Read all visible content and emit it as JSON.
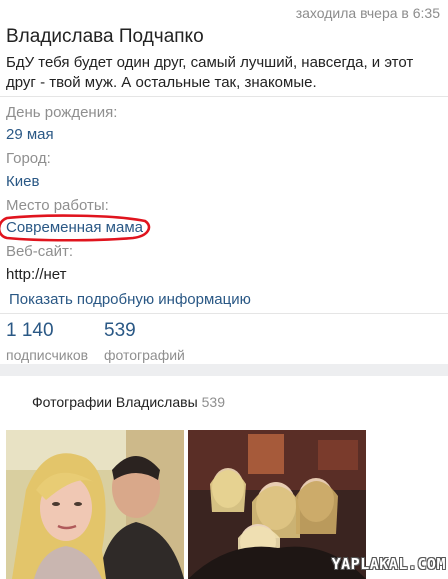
{
  "profile": {
    "last_seen": "заходила вчера в 6:35",
    "name": "Владислава Подчапко",
    "status": "БдУ тебя будет один друг, самый лучший, навсегда, и этот друг - твой муж. А остальные так, знакомые."
  },
  "info": {
    "birthday_label": "День рождения:",
    "birthday_value": "29 мая",
    "city_label": "Город:",
    "city_value": "Киев",
    "work_label": "Место работы:",
    "work_value": "Современная мама",
    "website_label": "Веб-сайт:",
    "website_value": "http://нет",
    "show_more": "Показать подробную информацию"
  },
  "counters": {
    "followers_count": "1 140",
    "followers_label": "подписчиков",
    "photos_count": "539",
    "photos_label": "фотографий"
  },
  "photos": {
    "title": "Фотографии Владиславы",
    "count": "539"
  },
  "watermark": "YAPLAKAL.COM",
  "colors": {
    "link": "#2a5885",
    "secondary_text": "#8f8f8f",
    "annotation_circle": "#e0141e"
  }
}
